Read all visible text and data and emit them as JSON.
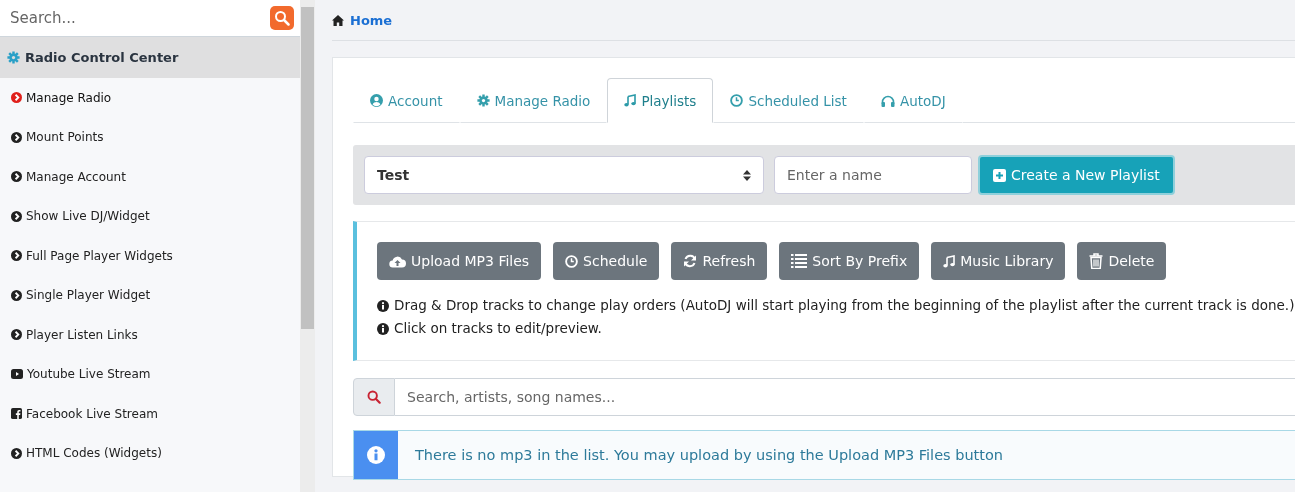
{
  "sidebar": {
    "search": {
      "placeholder": "Search..."
    },
    "header": "Radio Control Center",
    "items": [
      {
        "label": "Manage Radio",
        "kind": "chevron",
        "selected": true
      },
      {
        "label": "Mount Points",
        "kind": "chevron",
        "selected": false
      },
      {
        "label": "Manage Account",
        "kind": "chevron",
        "selected": false
      },
      {
        "label": "Show Live DJ/Widget",
        "kind": "chevron",
        "selected": false
      },
      {
        "label": "Full Page Player Widgets",
        "kind": "chevron",
        "selected": false
      },
      {
        "label": "Single Player Widget",
        "kind": "chevron",
        "selected": false
      },
      {
        "label": "Player Listen Links",
        "kind": "chevron",
        "selected": false
      },
      {
        "label": "Youtube Live Stream",
        "kind": "youtube",
        "selected": false
      },
      {
        "label": "Facebook Live Stream",
        "kind": "facebook",
        "selected": false
      },
      {
        "label": "HTML Codes (Widgets)",
        "kind": "chevron",
        "selected": false
      }
    ]
  },
  "breadcrumb": "Home",
  "tabs": [
    {
      "label": "Account",
      "kind": "user",
      "selected": false
    },
    {
      "label": "Manage Radio",
      "kind": "gear",
      "selected": false
    },
    {
      "label": "Playlists",
      "kind": "music",
      "selected": true
    },
    {
      "label": "Scheduled List",
      "kind": "clock",
      "selected": false
    },
    {
      "label": "AutoDJ",
      "kind": "headphones",
      "selected": false
    }
  ],
  "playlist_bar": {
    "select_value": "Test",
    "name_placeholder": "Enter a name",
    "create_button": "Create a New Playlist"
  },
  "actions": [
    {
      "label": "Upload MP3 Files",
      "kind": "upload"
    },
    {
      "label": "Schedule",
      "kind": "clock"
    },
    {
      "label": "Refresh",
      "kind": "refresh"
    },
    {
      "label": "Sort By Prefix",
      "kind": "list"
    },
    {
      "label": "Music Library",
      "kind": "music"
    },
    {
      "label": "Delete",
      "kind": "trash"
    }
  ],
  "notes": [
    "Drag & Drop tracks to change play orders (AutoDJ will start playing from the beginning of the playlist after the current track is done.)",
    "Click on tracks to edit/preview."
  ],
  "track_search": {
    "placeholder": "Search, artists, song names..."
  },
  "alert": "There is no mp3 in the list. You may upload by using the Upload MP3 Files button"
}
